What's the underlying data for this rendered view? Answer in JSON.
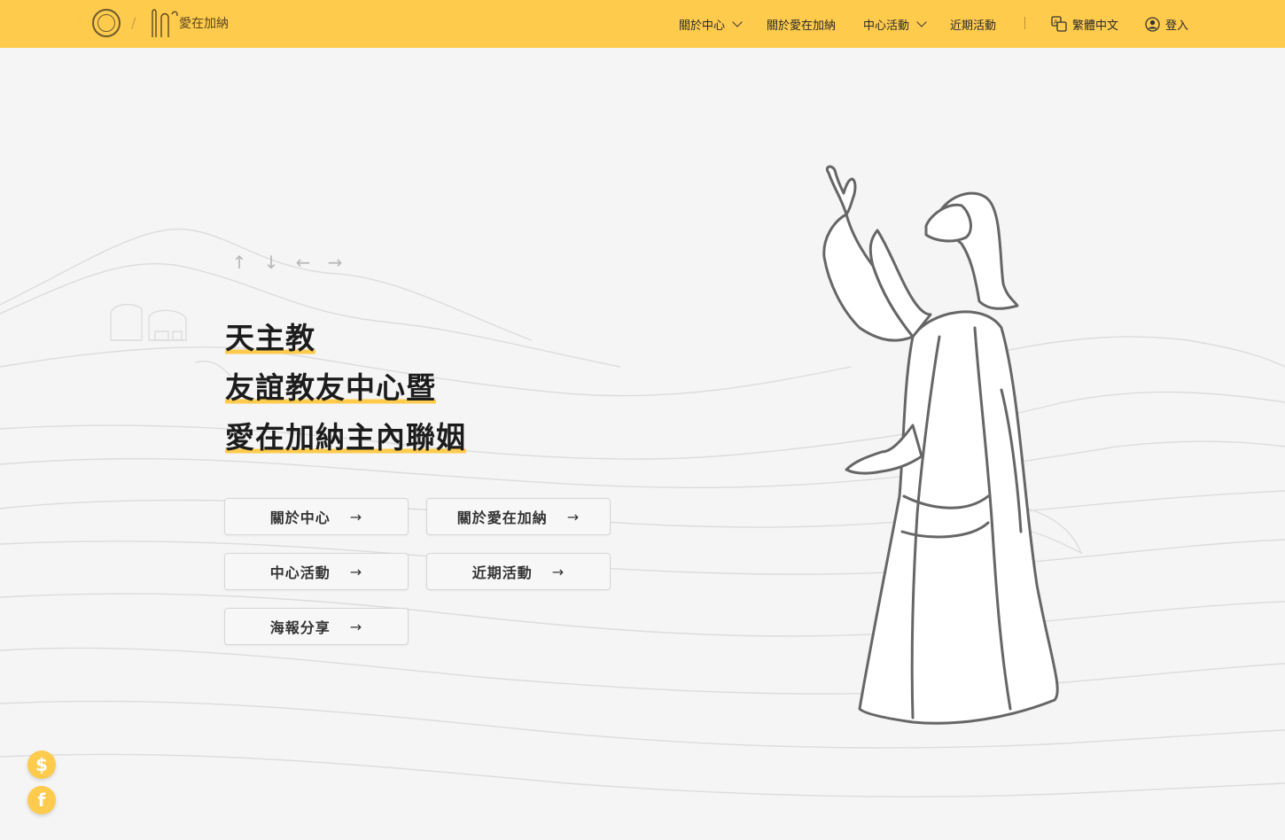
{
  "header": {
    "logo_brand_text": "愛在加納",
    "nav": [
      {
        "label": "關於中心",
        "has_dropdown": true
      },
      {
        "label": "關於愛在加納",
        "has_dropdown": false
      },
      {
        "label": "中心活動",
        "has_dropdown": true
      },
      {
        "label": "近期活動",
        "has_dropdown": false
      }
    ],
    "language_label": "繁體中文",
    "login_label": "登入"
  },
  "hero": {
    "title_lines": [
      "天主教",
      "友誼教友中心暨",
      "愛在加納主內聯姻"
    ],
    "buttons": [
      {
        "label": "關於中心"
      },
      {
        "label": "關於愛在加納"
      },
      {
        "label": "中心活動"
      },
      {
        "label": "近期活動"
      },
      {
        "label": "海報分享"
      }
    ],
    "arrow_icons": [
      "arrow-up-icon",
      "arrow-down-icon",
      "arrow-left-icon",
      "arrow-right-icon"
    ]
  },
  "floating": {
    "donate_icon": "dollar-icon",
    "social_icon": "facebook-icon"
  },
  "colors": {
    "accent": "#ffcb4d",
    "background": "#f5f5f5",
    "text": "#1c1c1c"
  }
}
